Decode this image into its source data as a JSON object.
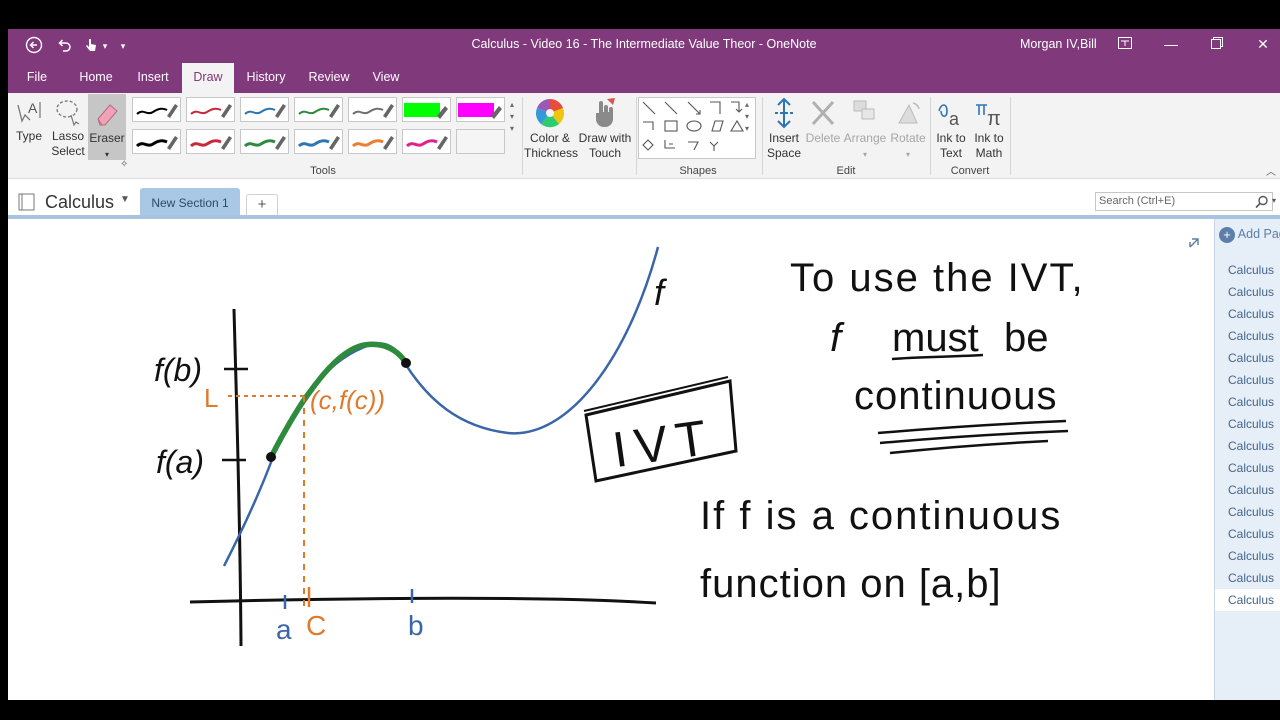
{
  "window": {
    "title": "Calculus - Video 16 - The Intermediate Value Theor  -  OneNote",
    "user": "Morgan IV,Bill"
  },
  "ribbon_tabs": [
    "File",
    "Home",
    "Insert",
    "Draw",
    "History",
    "Review",
    "View"
  ],
  "active_tab": "Draw",
  "tools": {
    "type_label": "Type",
    "lasso_label_1": "Lasso",
    "lasso_label_2": "Select",
    "eraser_label": "Eraser",
    "group_label": "Tools",
    "pen_colors_row1": [
      "#000000",
      "#c8283c",
      "#2e75b6",
      "#2e8b3e",
      "#707070",
      "#00ff00",
      "#ff00ff"
    ],
    "pen_colors_row2": [
      "#000000",
      "#c8283c",
      "#2e8b3e",
      "#2e75b6",
      "#ed7d31",
      "#e0218a",
      "#ffffff"
    ]
  },
  "color_thickness": {
    "line1": "Color &",
    "line2": "Thickness"
  },
  "draw_touch": {
    "line1": "Draw with",
    "line2": "Touch"
  },
  "shapes": {
    "group_label": "Shapes"
  },
  "edit": {
    "insert_space_1": "Insert",
    "insert_space_2": "Space",
    "delete": "Delete",
    "arrange": "Arrange",
    "rotate": "Rotate",
    "group_label": "Edit"
  },
  "convert": {
    "ink_text_1": "Ink to",
    "ink_text_2": "Text",
    "ink_math_1": "Ink to",
    "ink_math_2": "Math",
    "group_label": "Convert"
  },
  "notebook": {
    "name": "Calculus",
    "section": "New Section 1",
    "add_section": "+",
    "search_placeholder": "Search (Ctrl+E)"
  },
  "page_pane": {
    "add_page": "Add Page",
    "pages": [
      "Calculus",
      "Calculus",
      "Calculus",
      "Calculus",
      "Calculus",
      "Calculus",
      "Calculus",
      "Calculus",
      "Calculus",
      "Calculus",
      "Calculus",
      "Calculus",
      "Calculus",
      "Calculus",
      "Calculus",
      "Calculus"
    ],
    "selected_index": 15
  },
  "ink": {
    "f_label": "f",
    "fb_label": "f(b)",
    "fa_label": "f(a)",
    "L_label": "L",
    "point_label": "(c,f(c))",
    "a_label": "a",
    "c_label": "C",
    "b_label": "b",
    "ivt_box": "IVT",
    "note_line1": "To use the IVT,",
    "note_line2_pre": "f",
    "note_line2_must": "must",
    "note_line2_post": "be",
    "note_line3": "continuous",
    "stmt_line1": "If  f  is a continuous",
    "stmt_line2": "function  on  [a,b]"
  },
  "colors": {
    "brand": "#80397b",
    "ink_black": "#111111",
    "ink_blue": "#3a66a8",
    "ink_green": "#2e8b3e",
    "ink_orange": "#e07a2a"
  }
}
